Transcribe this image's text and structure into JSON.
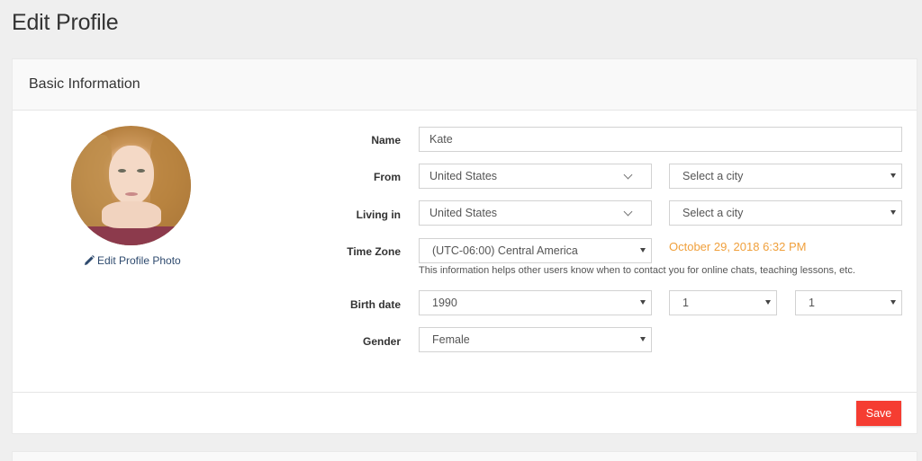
{
  "page": {
    "title": "Edit Profile"
  },
  "card": {
    "header": "Basic Information",
    "photo": {
      "alt": "Profile photo",
      "edit_label": "Edit Profile Photo",
      "edit_icon": "pencil-icon"
    },
    "form": {
      "name": {
        "label": "Name",
        "value": "Kate"
      },
      "from": {
        "label": "From",
        "country": "United States",
        "city_placeholder": "Select a city"
      },
      "living_in": {
        "label": "Living in",
        "country": "United States",
        "city_placeholder": "Select a city"
      },
      "time_zone": {
        "label": "Time Zone",
        "value": "(UTC-06:00) Central America",
        "local_time": "October 29, 2018 6:32 PM",
        "help": "This information helps other users know when to contact you for online chats, teaching lessons, etc."
      },
      "birth_date": {
        "label": "Birth date",
        "year": "1990",
        "month": "1",
        "day": "1"
      },
      "gender": {
        "label": "Gender",
        "value": "Female"
      }
    },
    "footer": {
      "save_label": "Save"
    }
  },
  "colors": {
    "accent": "#f53d32",
    "time": "#f0a03c",
    "link": "#2e4a6e"
  }
}
